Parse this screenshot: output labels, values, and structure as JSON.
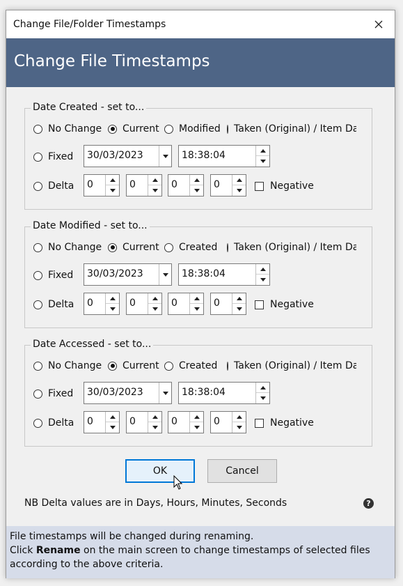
{
  "window": {
    "title": "Change File/Folder Timestamps"
  },
  "banner": {
    "title": "Change File Timestamps"
  },
  "groups": [
    {
      "legend": "Date Created - set to...",
      "options": [
        "No Change",
        "Current",
        "Modified",
        "Taken (Original) / Item Date"
      ],
      "selected": "Current",
      "fixed_label": "Fixed",
      "date_value": "30/03/2023",
      "time_value": "18:38:04",
      "delta_label": "Delta",
      "delta_values": [
        "0",
        "0",
        "0",
        "0"
      ],
      "negative_label": "Negative",
      "negative_checked": false
    },
    {
      "legend": "Date Modified - set to...",
      "options": [
        "No Change",
        "Current",
        "Created",
        "Taken (Original) / Item Date"
      ],
      "selected": "Current",
      "fixed_label": "Fixed",
      "date_value": "30/03/2023",
      "time_value": "18:38:04",
      "delta_label": "Delta",
      "delta_values": [
        "0",
        "0",
        "0",
        "0"
      ],
      "negative_label": "Negative",
      "negative_checked": false
    },
    {
      "legend": "Date Accessed - set to...",
      "options": [
        "No Change",
        "Current",
        "Created",
        "Taken (Original) / Item Date"
      ],
      "selected": "Current",
      "fixed_label": "Fixed",
      "date_value": "30/03/2023",
      "time_value": "18:38:04",
      "delta_label": "Delta",
      "delta_values": [
        "0",
        "0",
        "0",
        "0"
      ],
      "negative_label": "Negative",
      "negative_checked": false
    }
  ],
  "buttons": {
    "ok": "OK",
    "cancel": "Cancel"
  },
  "note": "NB Delta values are in Days, Hours, Minutes, Seconds",
  "info": {
    "line1": "File timestamps will be changed during renaming.",
    "line2_prefix": "Click ",
    "line2_bold": "Rename",
    "line2_suffix": " on the main screen to change timestamps of selected files",
    "line3": "according to the above criteria."
  },
  "colors": {
    "banner": "#4e6586",
    "info_bg": "#d6dce9",
    "default_button_border": "#0078d7"
  },
  "icons": {
    "close": "close-icon",
    "help": "help-icon",
    "cursor": "mouse-pointer-icon"
  }
}
